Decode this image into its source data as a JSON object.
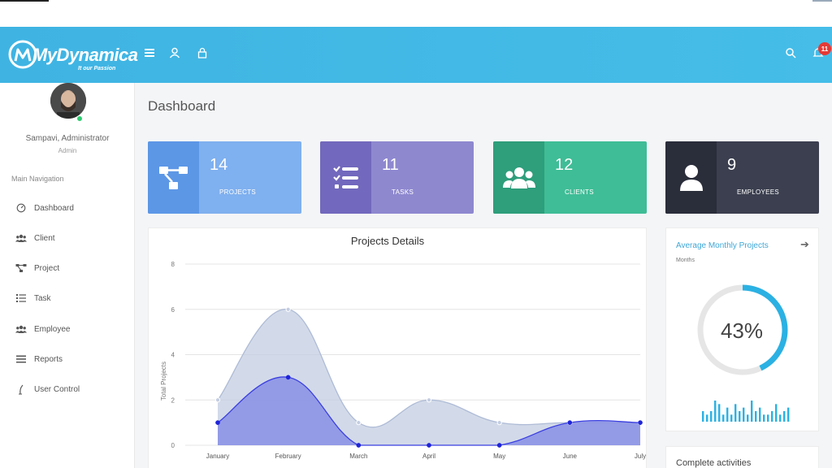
{
  "app": {
    "brand": "MyDynamica",
    "tagline": "It our Passion"
  },
  "header": {
    "notifications_count": "11",
    "icons": [
      "menu-icon",
      "user-icon",
      "lock-icon",
      "search-icon",
      "bell-icon"
    ]
  },
  "sidebar": {
    "user_name": "Sampavi, Administrator",
    "user_role": "Admin",
    "nav_title": "Main Navigation",
    "items": [
      {
        "label": "Dashboard",
        "icon": "dashboard-icon"
      },
      {
        "label": "Client",
        "icon": "users-icon"
      },
      {
        "label": "Project",
        "icon": "project-icon"
      },
      {
        "label": "Task",
        "icon": "tasks-icon"
      },
      {
        "label": "Employee",
        "icon": "users-icon"
      },
      {
        "label": "Reports",
        "icon": "list-icon"
      },
      {
        "label": "User Control",
        "icon": "pen-icon"
      }
    ]
  },
  "page": {
    "title": "Dashboard"
  },
  "stats": [
    {
      "value": "14",
      "label": "PROJECTS",
      "icon": "sitemap-icon",
      "color": "#7fb0ef",
      "icon_bg": "#5c97e6"
    },
    {
      "value": "11",
      "label": "TASKS",
      "icon": "tasks-icon",
      "color": "#8e88cf",
      "icon_bg": "#7268bd"
    },
    {
      "value": "12",
      "label": "CLIENTS",
      "icon": "users-icon",
      "color": "#3fbd96",
      "icon_bg": "#2e9e7b"
    },
    {
      "value": "9",
      "label": "EMPLOYEES",
      "icon": "user-icon",
      "color": "#3b3f4f",
      "icon_bg": "#2a2d3a"
    }
  ],
  "avg_projects": {
    "title": "Average Monthly Projects",
    "subtitle": "Months",
    "percent_label": "43%",
    "percent": 0.43,
    "accent": "#2bb1e3",
    "sparkline": [
      3,
      2,
      3,
      6,
      5,
      2,
      4,
      2,
      5,
      3,
      4,
      2,
      6,
      3,
      4,
      2,
      2,
      3,
      5,
      2,
      3,
      4
    ]
  },
  "activities": {
    "title": "Complete activities"
  },
  "chart_data": {
    "type": "area",
    "title": "Projects Details",
    "xlabel": "",
    "ylabel": "Total Projects",
    "categories": [
      "January",
      "February",
      "March",
      "April",
      "May",
      "June",
      "July"
    ],
    "ylim": [
      0,
      8
    ],
    "yticks": [
      0,
      2,
      4,
      6,
      8
    ],
    "grid": true,
    "series": [
      {
        "values": [
          2,
          6,
          1,
          2,
          1,
          1,
          1
        ],
        "color": "#c3cde2"
      },
      {
        "values": [
          1,
          3,
          0,
          0,
          0,
          1,
          1
        ],
        "color": "#8c93e6"
      }
    ]
  }
}
